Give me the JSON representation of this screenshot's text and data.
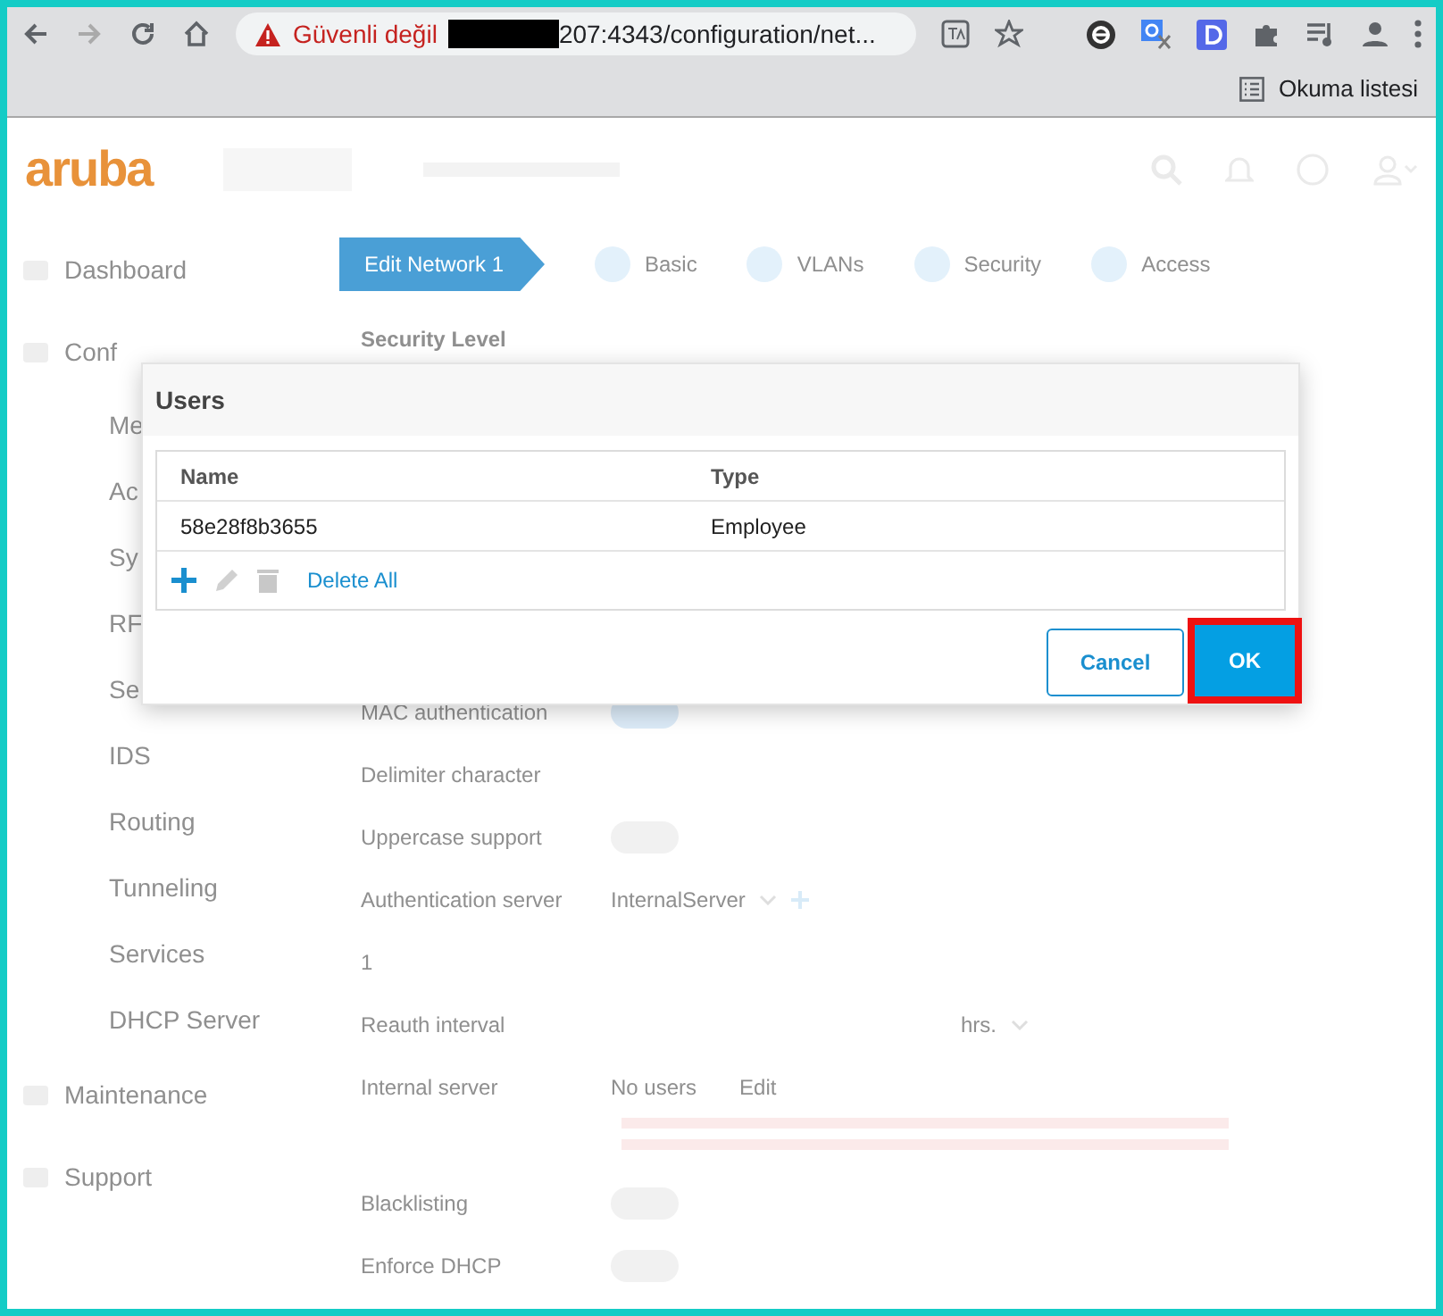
{
  "browser": {
    "security_label": "Güvenli değil",
    "url": "207:4343/configuration/net...",
    "reading_list": "Okuma listesi"
  },
  "app": {
    "logo": "aruba",
    "sidebar": [
      {
        "label": "Dashboard",
        "kind": "top"
      },
      {
        "label": "Conf",
        "kind": "top"
      },
      {
        "label": "Me",
        "kind": "sub"
      },
      {
        "label": "Ac",
        "kind": "sub"
      },
      {
        "label": "Sy",
        "kind": "sub"
      },
      {
        "label": "RF",
        "kind": "sub"
      },
      {
        "label": "Se",
        "kind": "sub"
      },
      {
        "label": "IDS",
        "kind": "sub"
      },
      {
        "label": "Routing",
        "kind": "sub"
      },
      {
        "label": "Tunneling",
        "kind": "sub"
      },
      {
        "label": "Services",
        "kind": "sub"
      },
      {
        "label": "DHCP Server",
        "kind": "sub"
      },
      {
        "label": "Maintenance",
        "kind": "top"
      },
      {
        "label": "Support",
        "kind": "top"
      }
    ],
    "wizard_steps": [
      {
        "label": "Edit Network 1",
        "selected": true
      },
      {
        "label": "Basic",
        "selected": false
      },
      {
        "label": "VLANs",
        "selected": false
      },
      {
        "label": "Security",
        "selected": false
      },
      {
        "label": "Access",
        "selected": false
      }
    ],
    "form": [
      {
        "kind": "heading",
        "label": "Security Level"
      },
      {
        "kind": "toggle",
        "label": "MAC authentication",
        "on": true
      },
      {
        "kind": "plain",
        "label": "Delimiter character"
      },
      {
        "kind": "toggle",
        "label": "Uppercase support",
        "on": false
      },
      {
        "kind": "select",
        "label": "Authentication server",
        "value": "InternalServer"
      },
      {
        "kind": "plain",
        "label": "1"
      },
      {
        "kind": "select",
        "label": "Reauth interval",
        "value": "hrs."
      },
      {
        "kind": "users",
        "label": "Internal server",
        "value": "No users",
        "link": "Edit"
      },
      {
        "kind": "toggle",
        "label": "Blacklisting",
        "on": false
      },
      {
        "kind": "toggle",
        "label": "Enforce DHCP",
        "on": false
      }
    ]
  },
  "dialog": {
    "title": "Users",
    "columns": [
      "Name",
      "Type"
    ],
    "rows": [
      [
        "58e28f8b3655",
        "Employee"
      ]
    ],
    "delete_all": "Delete All",
    "buttons": [
      {
        "label": "Cancel",
        "kind": "secondary",
        "highlighted": false
      },
      {
        "label": "OK",
        "kind": "primary",
        "highlighted": true
      }
    ]
  }
}
